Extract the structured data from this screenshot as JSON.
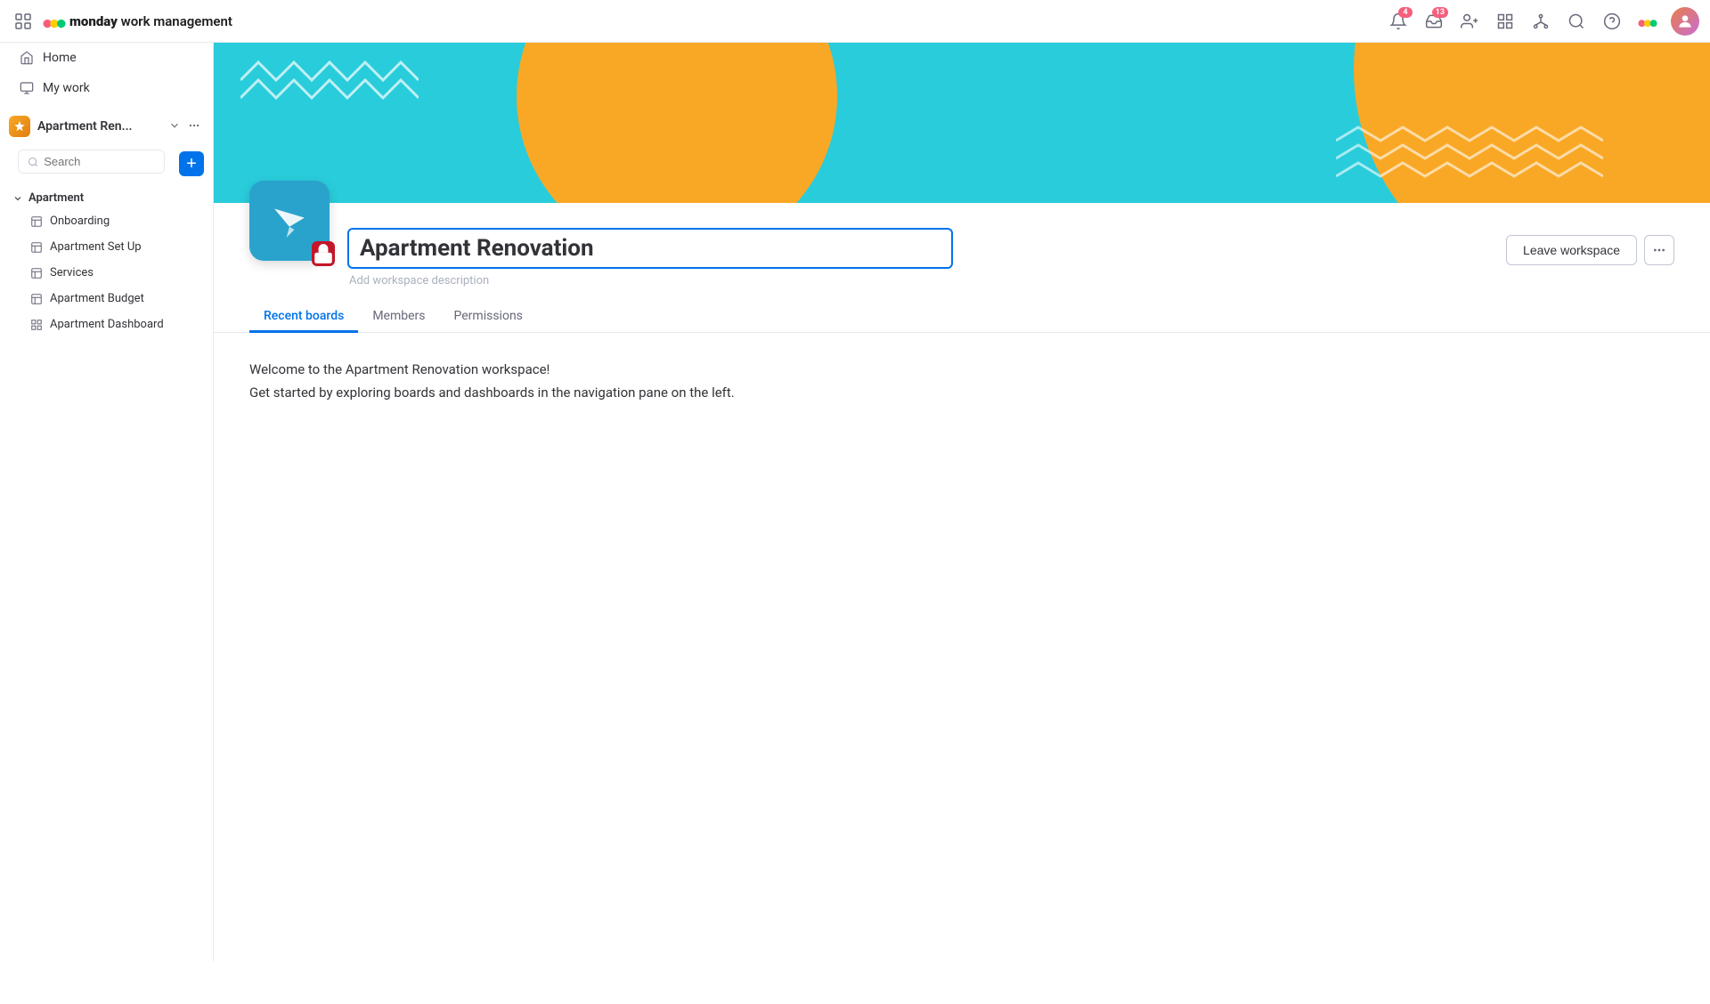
{
  "app": {
    "title": "monday work management",
    "logo_bold": "monday",
    "logo_rest": " work management"
  },
  "topnav": {
    "notifications_badge": "4",
    "inbox_badge": "13"
  },
  "sidebar": {
    "home_label": "Home",
    "mywork_label": "My work",
    "search_placeholder": "Search",
    "add_btn_label": "+",
    "workspace_name": "Apartment Ren...",
    "section_label": "Apartment",
    "items": [
      {
        "label": "Onboarding"
      },
      {
        "label": "Apartment Set Up"
      },
      {
        "label": "Services"
      },
      {
        "label": "Apartment Budget"
      },
      {
        "label": "Apartment Dashboard"
      }
    ]
  },
  "workspace": {
    "title": "Apartment Renovation",
    "description_placeholder": "Add workspace description",
    "leave_btn": "Leave workspace",
    "tabs": [
      "Recent boards",
      "Members",
      "Permissions"
    ],
    "active_tab": 0,
    "welcome_line1": "Welcome to the Apartment Renovation workspace!",
    "welcome_line2": "Get started by exploring boards and dashboards in the navigation pane on the left."
  }
}
